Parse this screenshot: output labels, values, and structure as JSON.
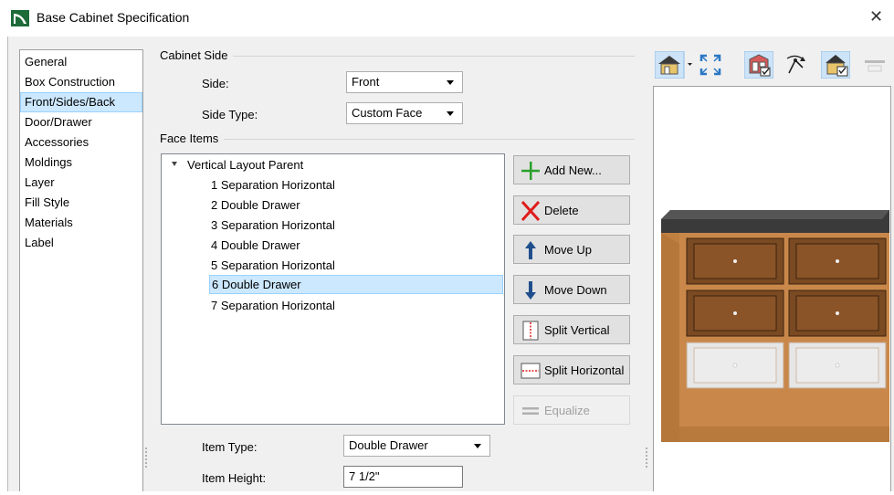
{
  "window": {
    "title": "Base Cabinet Specification"
  },
  "icons": {
    "app": "chief-architect-icon",
    "close": "close-icon"
  },
  "colors": {
    "selection": "#cce8ff",
    "selection_border": "#99d1ff",
    "dialog_bg": "#f0f0f0"
  },
  "nav": {
    "items": [
      {
        "label": "General"
      },
      {
        "label": "Box Construction"
      },
      {
        "label": "Front/Sides/Back",
        "selected": true
      },
      {
        "label": "Door/Drawer"
      },
      {
        "label": "Accessories"
      },
      {
        "label": "Moldings"
      },
      {
        "label": "Layer"
      },
      {
        "label": "Fill Style"
      },
      {
        "label": "Materials"
      },
      {
        "label": "Label"
      }
    ]
  },
  "cabinet_side": {
    "group_label": "Cabinet Side",
    "side_label": "Side:",
    "side_value": "Front",
    "side_type_label": "Side Type:",
    "side_type_value": "Custom Face"
  },
  "face_items": {
    "group_label": "Face Items",
    "tree": {
      "parent": "Vertical Layout Parent",
      "children": [
        "1 Separation Horizontal",
        "2 Double Drawer",
        "3 Separation Horizontal",
        "4 Double Drawer",
        "5 Separation Horizontal",
        "6 Double Drawer",
        "7 Separation Horizontal"
      ],
      "selected_index": 5
    },
    "buttons": {
      "add_new": "Add New...",
      "delete": "Delete",
      "move_up": "Move Up",
      "move_down": "Move Down",
      "split_vertical": "Split Vertical",
      "split_horizontal": "Split Horizontal",
      "equalize": "Equalize"
    },
    "item_type_label": "Item Type:",
    "item_type_value": "Double Drawer",
    "item_height_label": "Item Height:",
    "item_height_value": "7 1/2\""
  },
  "preview_toolbar": {
    "icons": [
      "camera-view-dropdown-icon",
      "fill-window-icon",
      "show-cabinet-icon",
      "orbit-icon",
      "show-selected-face-icon",
      "disabled-tool-icon"
    ]
  }
}
